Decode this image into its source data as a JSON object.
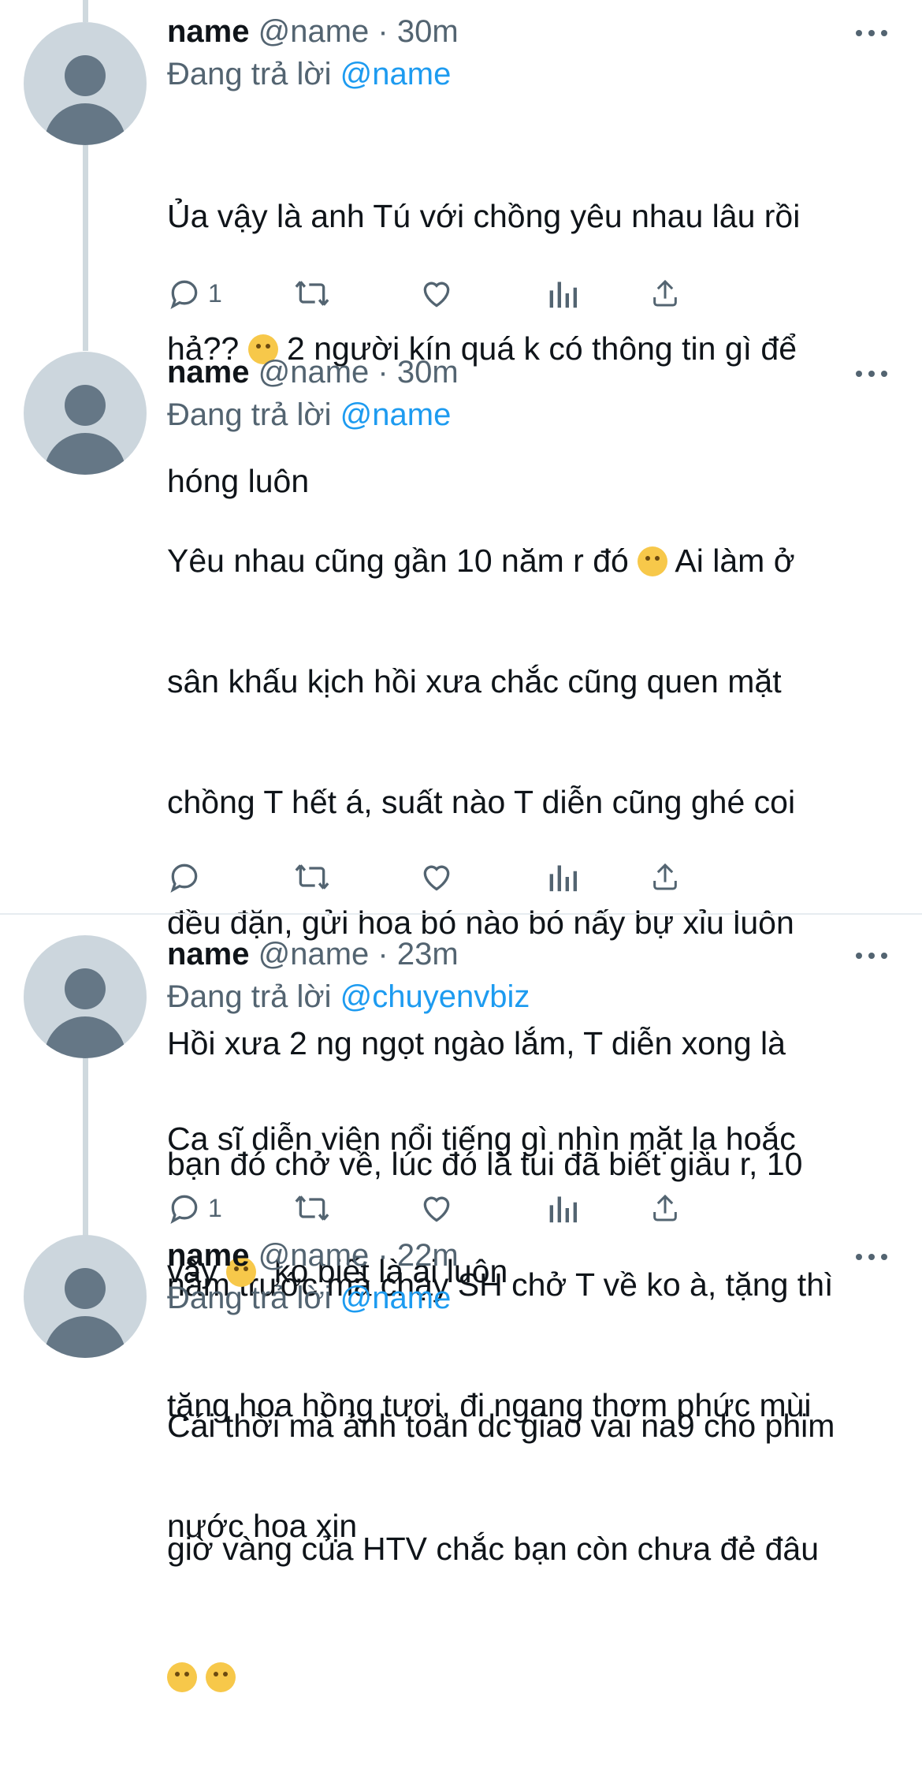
{
  "tweets": [
    {
      "name": "name",
      "handle": "@name",
      "dot": "·",
      "time": "30m",
      "reply_prefix": "Đang trả lời",
      "reply_to": "@name",
      "text_lines": [
        "Ủa vậy là anh Tú với chồng yêu nhau lâu rồi",
        "hả??",
        "2 người kín quá k có thông tin gì để",
        "hóng luôn"
      ],
      "emojis": [
        "sad-tear-emoji"
      ],
      "reply_count": "1"
    },
    {
      "name": "name",
      "handle": "@name",
      "dot": "·",
      "time": "30m",
      "reply_prefix": "Đang trả lời",
      "reply_to": "@name",
      "text_lines": [
        "Yêu nhau cũng gần 10 năm r đó",
        "Ai làm ở",
        "sân khấu kịch hồi xưa chắc cũng quen mặt",
        "chồng T hết á, suất nào T diễn cũng ghé coi",
        "đều đặn, gửi hoa bó nào bó nấy bự xỉu luôn",
        "Hồi xưa 2 ng ngọt ngào lắm, T diễn xong là",
        "bạn đó chở về, lúc đó là tui đã biết giàu r, 10",
        "năm trước mà chạy SH chở T về ko à, tặng thì",
        "tặng hoa hồng tươi, đi ngang thơm phức mùi",
        "nước hoa xịn"
      ],
      "emojis": [
        "laughing-tears-emoji"
      ],
      "reply_count": ""
    },
    {
      "name": "name",
      "handle": "@name",
      "dot": "·",
      "time": "23m",
      "reply_prefix": "Đang trả lời",
      "reply_to": "@chuyenvbiz",
      "text_lines": [
        "Ca sĩ diễn viên nổi tiếng gì nhìn mặt lạ hoắc",
        "vậy",
        "ko biết là ai luôn"
      ],
      "emojis": [
        "laughing-tears-emoji"
      ],
      "reply_count": "1"
    },
    {
      "name": "name",
      "handle": "@name",
      "dot": "·",
      "time": "22m",
      "reply_prefix": "Đang trả lời",
      "reply_to": "@name",
      "text_lines": [
        "Cái thời mà ảnh toàn dc giao vai na9 cho phim",
        "giờ vàng của HTV chắc bạn còn chưa đẻ đâu"
      ],
      "emojis": [
        "rofl-emoji",
        "rofl-emoji"
      ]
    }
  ],
  "icons": {
    "reply": "reply-icon",
    "retweet": "retweet-icon",
    "like": "like-icon",
    "analytics": "analytics-icon",
    "share": "share-icon",
    "more": "more-icon"
  },
  "colors": {
    "accent": "#1d9bf0",
    "secondary_text": "#536471",
    "thread_line": "#cfd9de"
  }
}
